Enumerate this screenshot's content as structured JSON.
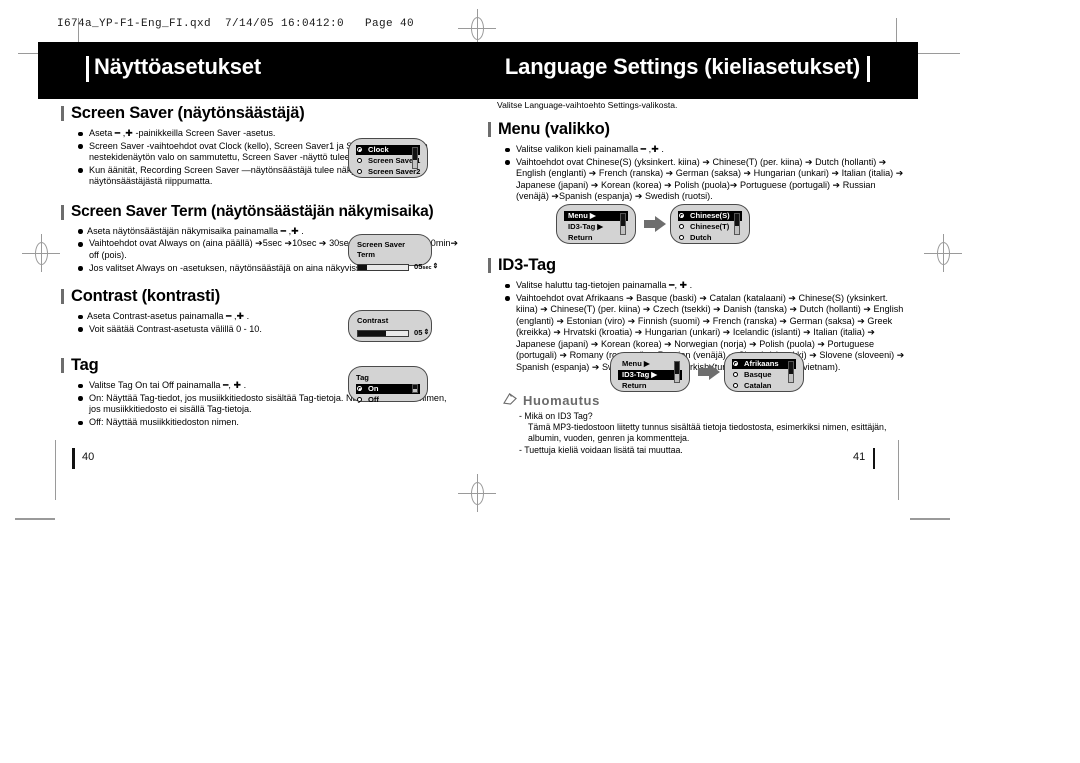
{
  "fileinfo": "I674a_YP-F1-Eng_FI.qxd  7/14/05 16:0412:0   Page 40",
  "header": {
    "left_title": "Näyttöasetukset",
    "right_title": "Language Settings (kieliasetukset)"
  },
  "folio": {
    "left": "40",
    "right": "41"
  },
  "left_column": {
    "screen_saver": {
      "heading": "Screen Saver (näytönsäästäjä)",
      "bullets": [
        "Aseta ━ ,✚ -painikkeilla Screen Saver -asetus.",
        "Screen Saver -vaihtoehdot ovat Clock (kello), Screen Saver1 ja Screen Saver2. Kun nestekidenäytön valo on sammutettu, Screen Saver -näyttö tulee näkyviin.",
        "Kun äänität, Recording Screen Saver —näytönsäästäjä tulee näkyviin asetetusta näytönsäästäjästä riippumatta."
      ],
      "lcd": {
        "items": [
          {
            "label": "Clock",
            "selected": true
          },
          {
            "label": "Screen Saver1",
            "selected": false
          },
          {
            "label": "Screen Saver2",
            "selected": false
          }
        ]
      }
    },
    "screen_saver_term": {
      "heading": "Screen Saver Term (näytönsäästäjän näkymisaika)",
      "bullets": [
        "Aseta näytönsäästäjän näkymisaika painamalla ━ ,✚ .",
        "Vaihtoehdot ovat Always on (aina päällä) ➔5sec ➔10sec ➔ 30sec ➔1min ➔ 5min ➔10min➔ off (pois).",
        "Jos valitset Always on -asetuksen, näytönsäästäjä on aina näkyvissä."
      ],
      "lcd": {
        "title": "Screen Saver Term",
        "value": "05",
        "unit": "sec",
        "fill_percent": 18
      }
    },
    "contrast": {
      "heading": "Contrast (kontrasti)",
      "bullets": [
        "Aseta Contrast-asetus painamalla ━ ,✚ .",
        "Voit säätää Contrast-asetusta välillä 0 - 10."
      ],
      "lcd": {
        "title": "Contrast",
        "value": "05",
        "unit": "",
        "fill_percent": 55
      }
    },
    "tag": {
      "heading": "Tag",
      "bullets": [
        "Valitse Tag On tai Off painamalla ━, ✚ .",
        "On: Näyttää Tag-tiedot, jos musiikkitiedosto sisältää Tag-tietoja. Näyttää tiedoston nimen, jos musiikkitiedosto ei sisällä Tag-tietoja.",
        "Off: Näyttää musiikkitiedoston nimen."
      ],
      "lcd": {
        "title": "Tag",
        "items": [
          {
            "label": "On",
            "selected": true
          },
          {
            "label": "Off",
            "selected": false
          }
        ]
      }
    }
  },
  "right_column": {
    "intro": "Valitse Language-vaihtoehto Settings-valikosta.",
    "menu": {
      "heading": "Menu (valikko)",
      "bullets": [
        "Valitse valikon kieli painamalla ━ ,✚ .",
        "Vaihtoehdot ovat Chinese(S) (yksinkert. kiina) ➔ Chinese(T) (per. kiina) ➔ Dutch (hollanti) ➔  English (englanti) ➔ French (ranska) ➔ German (saksa) ➔ Hungarian (unkari) ➔ Italian (italia) ➔ Japanese (japani) ➔  Korean (korea) ➔ Polish (puola)➔ Portuguese (portugali) ➔ Russian (venäjä) ➔Spanish (espanja) ➔ Swedish (ruotsi)."
      ],
      "lcd_left": {
        "rows": [
          {
            "label": "Menu",
            "arrow": "▶",
            "selected": true
          },
          {
            "label": "ID3-Tag",
            "arrow": "▶",
            "selected": false
          },
          {
            "label": "Return",
            "arrow": "",
            "selected": false
          }
        ]
      },
      "lcd_right": {
        "items": [
          {
            "label": "Chinese(S)",
            "selected": true
          },
          {
            "label": "Chinese(T)",
            "selected": false
          },
          {
            "label": "Dutch",
            "selected": false
          }
        ]
      }
    },
    "id3tag": {
      "heading": "ID3-Tag",
      "bullets": [
        "Valitse haluttu tag-tietojen painamalla ━, ✚ .",
        "Vaihtoehdot ovat Afrikaans ➔ Basque (baski) ➔ Catalan (katalaani) ➔ Chinese(S) (yksinkert. kiina) ➔ Chinese(T) (per. kiina) ➔ Czech (tsekki) ➔ Danish (tanska) ➔ Dutch (hollanti) ➔  English (englanti) ➔ Estonian (viro) ➔ Finnish (suomi) ➔ French (ranska) ➔ German (saksa) ➔ Greek (kreikka) ➔ Hrvatski (kroatia) ➔ Hungarian (unkari) ➔ Icelandic (islanti) ➔ Italian (italia) ➔ Japanese (japani) ➔  Korean (korea) ➔ Norwegian (norja) ➔ Polish (puola) ➔ Portuguese (portugali) ➔ Romany (romaani) ➔ Russian (venäjä) ➔ Slovak (slovakki) ➔ Slovene (sloveeni) ➔ Spanish (espanja) ➔ Swedish (ruotsi) ➔ Turkish (turkki) ➔Vietnamese (vietnam)."
      ],
      "lcd_left": {
        "rows": [
          {
            "label": "Menu",
            "arrow": "▶",
            "selected": false
          },
          {
            "label": "ID3-Tag",
            "arrow": "▶",
            "selected": true
          },
          {
            "label": "Return",
            "arrow": "",
            "selected": false
          }
        ]
      },
      "lcd_right": {
        "items": [
          {
            "label": "Afrikaans",
            "selected": true
          },
          {
            "label": "Basque",
            "selected": false
          },
          {
            "label": "Catalan",
            "selected": false
          }
        ]
      }
    },
    "note": {
      "heading": "Huomautus",
      "lines": [
        "- Mikä on ID3 Tag?",
        "Tämä MP3-tiedostoon liitetty tunnus sisältää tietoja tiedostosta, esimerkiksi nimen, esittäjän, albumin, vuoden, genren ja kommentteja.",
        "- Tuettuja kieliä voidaan lisätä tai muuttaa."
      ]
    }
  }
}
